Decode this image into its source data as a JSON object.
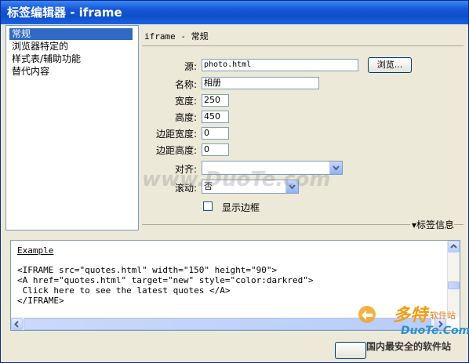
{
  "window": {
    "title": "标签编辑器 - iframe"
  },
  "tree": {
    "items": [
      {
        "label": "常规",
        "selected": true
      },
      {
        "label": "浏览器特定的",
        "selected": false
      },
      {
        "label": "样式表/辅助功能",
        "selected": false
      },
      {
        "label": "替代内容",
        "selected": false
      }
    ]
  },
  "section": {
    "header": "iframe - 常规"
  },
  "form": {
    "src": {
      "label": "源:",
      "value": "photo.html"
    },
    "browse_label": "浏览...",
    "name": {
      "label": "名称:",
      "value": "相册"
    },
    "width": {
      "label": "宽度:",
      "value": "250"
    },
    "height": {
      "label": "高度:",
      "value": "450"
    },
    "margin_width": {
      "label": "边距宽度:",
      "value": "0"
    },
    "margin_height": {
      "label": "边距高度:",
      "value": "0"
    },
    "align": {
      "label": "对齐:",
      "value": ""
    },
    "scroll": {
      "label": "滚动:",
      "value": "否"
    },
    "show_border": {
      "label": "显示边框",
      "checked": false
    }
  },
  "tag_info": {
    "label": "▾标签信息"
  },
  "example": {
    "title": "Example",
    "lines": [
      "<IFRAME src=\"quotes.html\" width=\"150\" height=\"90\">",
      "<A href=\"quotes.html\" target=\"new\" style=\"color:darkred\">",
      " Click here to see the latest quotes </A>",
      "</IFRAME>"
    ]
  },
  "watermarks": {
    "center": "www.DuoTe.com",
    "brand_cn": "多特",
    "brand_sub": "软件站",
    "brand_en": "DuoTe.Com",
    "brand_slogan": "国内最安全的软件站"
  },
  "colors": {
    "title_bar": "#1758d8",
    "selection": "#316ac5",
    "window_bg": "#ece9d8"
  }
}
